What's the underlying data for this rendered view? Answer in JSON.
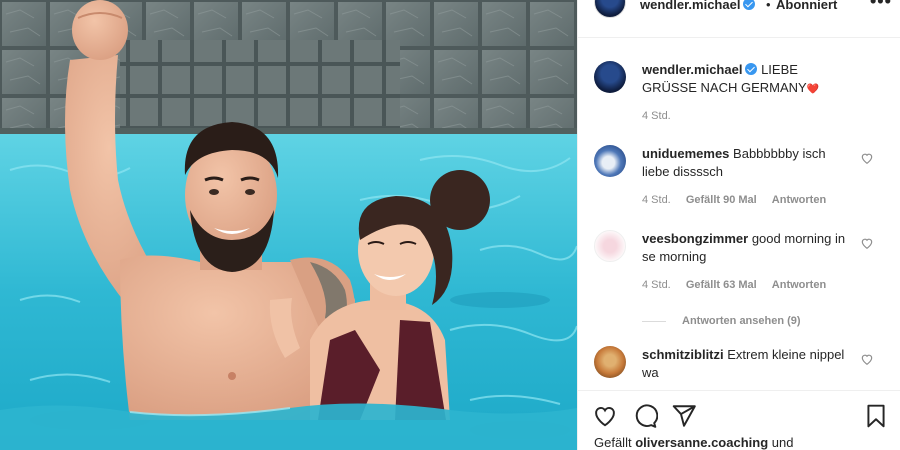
{
  "post": {
    "username": "wendler.michael",
    "separator": "•",
    "follow_state": "Abonniert",
    "more": "•••"
  },
  "caption": {
    "username": "wendler.michael",
    "text": "LIEBE GRÜSSE NACH GERMANY",
    "emoji": "❤️",
    "time": "4 Std."
  },
  "comments": [
    {
      "username": "uniduememes",
      "text": "Babbbbbby isch liebe dissssch",
      "time": "4 Std.",
      "likes": "Gefällt 90 Mal",
      "reply": "Antworten"
    },
    {
      "username": "veesbongzimmer",
      "text": "good morning in se morning",
      "time": "4 Std.",
      "likes": "Gefällt 63 Mal",
      "reply": "Antworten"
    },
    {
      "username": "schmitziblitzi",
      "text": "Extrem kleine nippel wa"
    }
  ],
  "view_replies": "Antworten ansehen (9)",
  "likes_line": {
    "prefix": "Gefällt",
    "user": "oliversanne.coaching",
    "suffix": "und"
  },
  "icons": {
    "header_avatar": "profile-avatar",
    "more": "more-options-icon",
    "comment_like": "heart-outline-icon",
    "like": "heart-outline-icon",
    "comment": "speech-bubble-icon",
    "share": "paper-plane-icon",
    "save": "bookmark-icon"
  },
  "colors": {
    "verified": "#3897f0",
    "text": "#262626",
    "meta": "#8e8e8e",
    "pool_water": "#3bbfd6"
  }
}
